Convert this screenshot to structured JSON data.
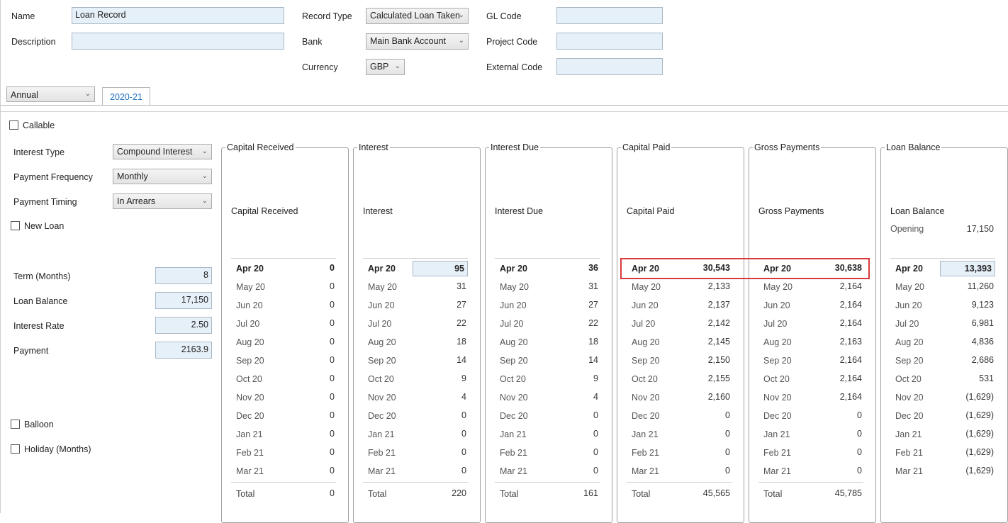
{
  "header": {
    "name_label": "Name",
    "name_value": "Loan Record",
    "description_label": "Description",
    "description_value": "",
    "record_type_label": "Record Type",
    "record_type_value": "Calculated Loan Taken",
    "bank_label": "Bank",
    "bank_value": "Main Bank Account",
    "currency_label": "Currency",
    "currency_value": "GBP",
    "gl_code_label": "GL Code",
    "gl_code_value": "",
    "project_code_label": "Project Code",
    "project_code_value": "",
    "external_code_label": "External Code",
    "external_code_value": ""
  },
  "period_select": "Annual",
  "tabs": [
    {
      "label": "2020-21"
    }
  ],
  "left": {
    "callable_label": "Callable",
    "interest_type_label": "Interest Type",
    "interest_type_value": "Compound Interest",
    "payment_frequency_label": "Payment Frequency",
    "payment_frequency_value": "Monthly",
    "payment_timing_label": "Payment Timing",
    "payment_timing_value": "In Arrears",
    "new_loan_label": "New Loan",
    "term_label": "Term (Months)",
    "term_value": "8",
    "loan_balance_label": "Loan Balance",
    "loan_balance_value": "17,150",
    "interest_rate_label": "Interest Rate",
    "interest_rate_value": "2.50",
    "payment_label": "Payment",
    "payment_value": "2163.9",
    "balloon_label": "Balloon",
    "holiday_label": "Holiday (Months)"
  },
  "panels": [
    {
      "title": "Capital Received",
      "subtitle": "Capital Received",
      "months": [
        "Apr 20",
        "May 20",
        "Jun 20",
        "Jul 20",
        "Aug 20",
        "Sep 20",
        "Oct 20",
        "Nov 20",
        "Dec 20",
        "Jan 21",
        "Feb 21",
        "Mar 21"
      ],
      "values": [
        "0",
        "0",
        "0",
        "0",
        "0",
        "0",
        "0",
        "0",
        "0",
        "0",
        "0",
        "0"
      ],
      "total_label": "Total",
      "total": "0"
    },
    {
      "title": "Interest",
      "subtitle": "Interest",
      "months": [
        "Apr 20",
        "May 20",
        "Jun 20",
        "Jul 20",
        "Aug 20",
        "Sep 20",
        "Oct 20",
        "Nov 20",
        "Dec 20",
        "Jan 21",
        "Feb 21",
        "Mar 21"
      ],
      "values": [
        "95",
        "31",
        "27",
        "22",
        "18",
        "14",
        "9",
        "4",
        "0",
        "0",
        "0",
        "0"
      ],
      "total_label": "Total",
      "total": "220"
    },
    {
      "title": "Interest Due",
      "subtitle": "Interest Due",
      "months": [
        "Apr 20",
        "May 20",
        "Jun 20",
        "Jul 20",
        "Aug 20",
        "Sep 20",
        "Oct 20",
        "Nov 20",
        "Dec 20",
        "Jan 21",
        "Feb 21",
        "Mar 21"
      ],
      "values": [
        "36",
        "31",
        "27",
        "22",
        "18",
        "14",
        "9",
        "4",
        "0",
        "0",
        "0",
        "0"
      ],
      "total_label": "Total",
      "total": "161"
    },
    {
      "title": "Capital Paid",
      "subtitle": "Capital Paid",
      "months": [
        "Apr 20",
        "May 20",
        "Jun 20",
        "Jul 20",
        "Aug 20",
        "Sep 20",
        "Oct 20",
        "Nov 20",
        "Dec 20",
        "Jan 21",
        "Feb 21",
        "Mar 21"
      ],
      "values": [
        "30,543",
        "2,133",
        "2,137",
        "2,142",
        "2,145",
        "2,150",
        "2,155",
        "2,160",
        "0",
        "0",
        "0",
        "0"
      ],
      "total_label": "Total",
      "total": "45,565"
    },
    {
      "title": "Gross Payments",
      "subtitle": "Gross Payments",
      "months": [
        "Apr 20",
        "May 20",
        "Jun 20",
        "Jul 20",
        "Aug 20",
        "Sep 20",
        "Oct 20",
        "Nov 20",
        "Dec 20",
        "Jan 21",
        "Feb 21",
        "Mar 21"
      ],
      "values": [
        "30,638",
        "2,164",
        "2,164",
        "2,164",
        "2,163",
        "2,164",
        "2,164",
        "2,164",
        "0",
        "0",
        "0",
        "0"
      ],
      "total_label": "Total",
      "total": "45,785"
    },
    {
      "title": "Loan Balance",
      "subtitle": "Loan Balance",
      "opening_label": "Opening",
      "opening_value": "17,150",
      "months": [
        "Apr 20",
        "May 20",
        "Jun 20",
        "Jul 20",
        "Aug 20",
        "Sep 20",
        "Oct 20",
        "Nov 20",
        "Dec 20",
        "Jan 21",
        "Feb 21",
        "Mar 21"
      ],
      "values": [
        "13,393",
        "11,260",
        "9,123",
        "6,981",
        "4,836",
        "2,686",
        "531",
        "(1,629)",
        "(1,629)",
        "(1,629)",
        "(1,629)",
        "(1,629)"
      ]
    }
  ],
  "colors": {
    "field_bg": "#e6f0f8",
    "highlight": "#d9393a",
    "tab_text": "#1f6fbf"
  }
}
